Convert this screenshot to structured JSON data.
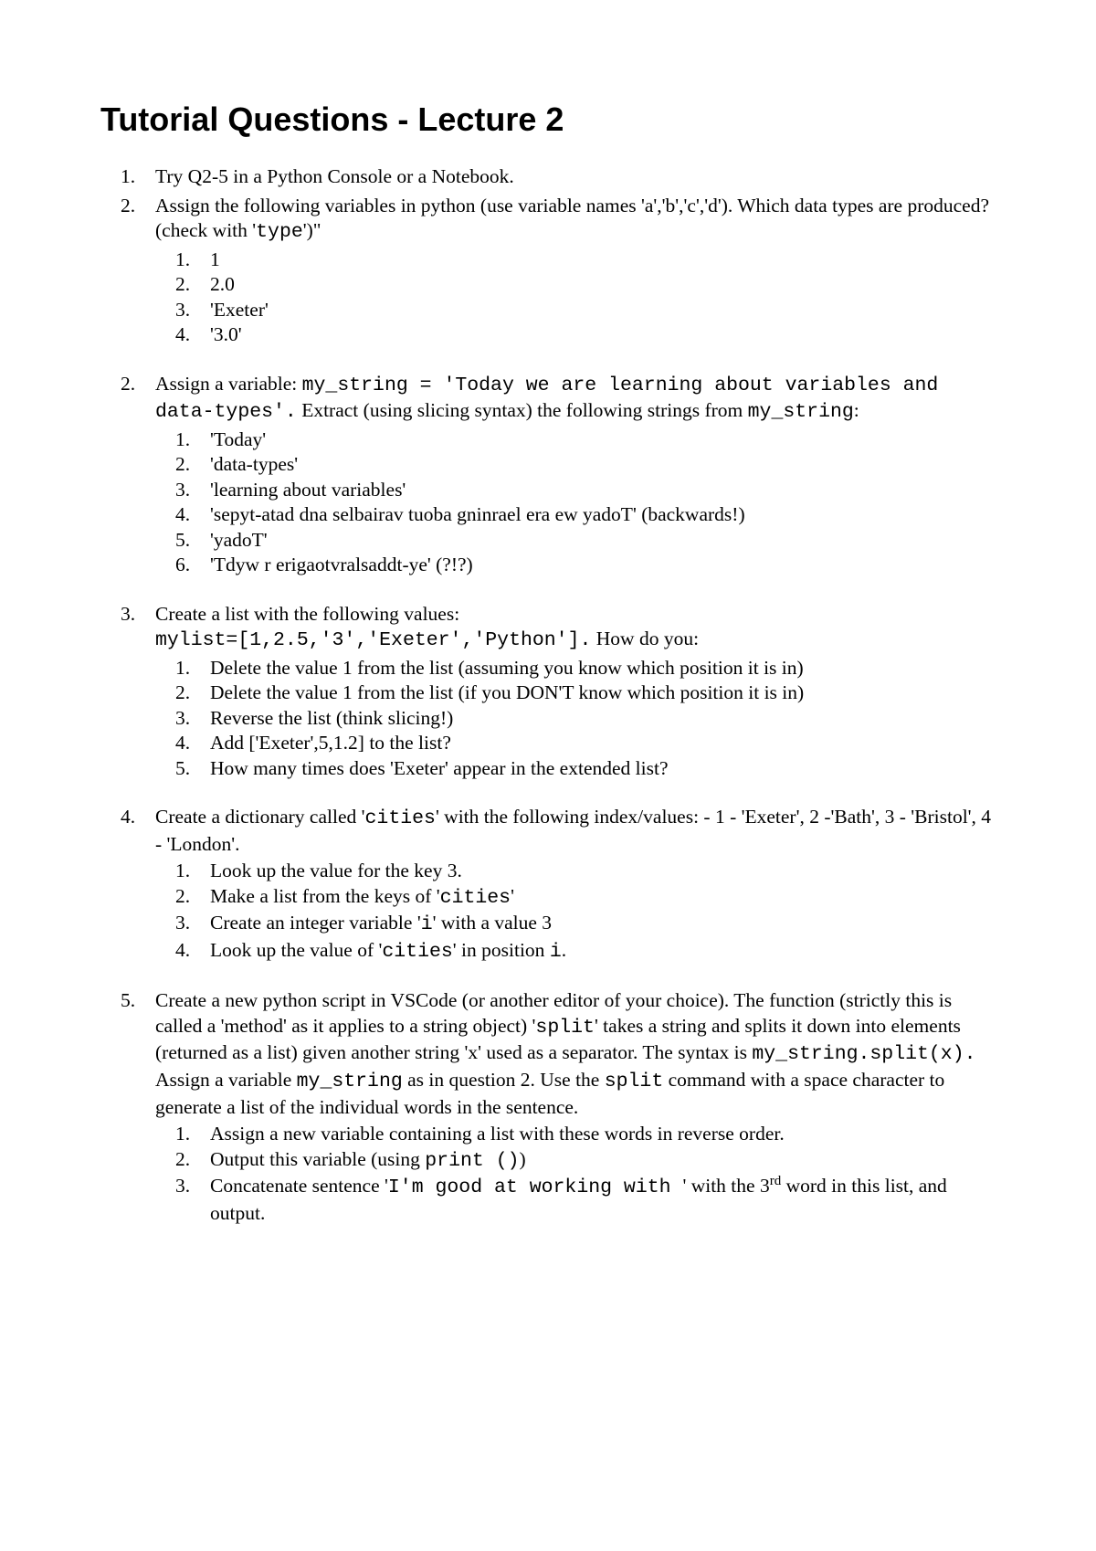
{
  "title": "Tutorial Questions - Lecture 2",
  "q1": {
    "num": "1.",
    "text": "Try Q2-5 in a Python Console or a Notebook."
  },
  "q2a": {
    "num": "2.",
    "text_a": "Assign the following variables in python (use variable names 'a','b','c','d'). Which data types are produced? (check with '",
    "code": "type",
    "text_b": "')\"",
    "items": {
      "n1": "1.",
      "v1": "1",
      "n2": "2.",
      "v2": "2.0",
      "n3": "3.",
      "v3": "'Exeter'",
      "n4": "4.",
      "v4": "'3.0'"
    }
  },
  "q2b": {
    "num": "2.",
    "t1": "Assign a variable: ",
    "code1": "my_string = 'Today we are learning about variables and data-types'.",
    "t2": "  Extract  (using slicing syntax) the following strings from ",
    "code2": "my_string",
    "t3": ":",
    "items": {
      "n1": "1.",
      "v1": "'Today'",
      "n2": "2.",
      "v2": "'data-types'",
      "n3": "3.",
      "v3": "'learning about variables'",
      "n4": "4.",
      "v4": "'sepyt-atad dna selbairav tuoba gninrael era ew yadoT' (backwards!)",
      "n5": "5.",
      "v5": "'yadoT'",
      "n6": "6.",
      "v6": " 'Tdyw r erigaotvralsaddt-ye' (?!?)"
    }
  },
  "q3": {
    "num": "3.",
    "t1": "Create a list with the following values: ",
    "code1": "mylist=[1,2.5,'3','Exeter','Python'].",
    "t2": "  How do you:",
    "items": {
      "n1": "1.",
      "v1": "Delete the value 1 from the list (assuming you know which position it is in)",
      "n2": "2.",
      "v2": "Delete the value 1 from the list (if you DON'T know which position it is in)",
      "n3": "3.",
      "v3": "Reverse the list (think slicing!)",
      "n4": "4.",
      "v4": "Add ['Exeter',5,1.2] to the list?",
      "n5": "5.",
      "v5": "How many times does 'Exeter' appear in the extended list?"
    }
  },
  "q4": {
    "num": "4.",
    "t1": "Create a dictionary called '",
    "code1": "cities",
    "t2": "' with the following index/values: - 1 - 'Exeter', 2 -'Bath',  3 - 'Bristol', 4 - 'London'.",
    "items": {
      "n1": "1.",
      "v1": "Look up the value for the key 3.",
      "n2": "2.",
      "v2a": "Make a list from the keys of '",
      "v2code": "cities",
      "v2b": "'",
      "n3": "3.",
      "v3a": "Create an integer variable '",
      "v3code": "i",
      "v3b": "' with a value 3",
      "n4": "4.",
      "v4a": "Look up the value of '",
      "v4code1": "cities",
      "v4b": "' in position ",
      "v4code2": "i",
      "v4c": "."
    }
  },
  "q5": {
    "num": "5.",
    "t1": "Create a new python script in VSCode (or another editor of your choice). The function (strictly this is called a 'method' as it applies to a string object) '",
    "code1": "split",
    "t2": "' takes a string and splits it down into elements (returned as a list) given another string 'x' used as a separator. The syntax is ",
    "code2": "my_string.split(x).",
    "t3": " Assign a variable ",
    "code3": "my_string",
    "t4": " as in question 2. Use the ",
    "code4": "split",
    "t5": " command with a space character to generate a list of the individual words in the sentence.",
    "items": {
      "n1": "1.",
      "v1": "Assign a new variable containing a list with these words in reverse order.",
      "n2": "2.",
      "v2a": "Output this variable (using ",
      "v2code": "print ()",
      "v2b": ")",
      "n3": "3.",
      "v3a": "Concatenate sentence '",
      "v3code": "I'm good at working with ",
      "v3b": "' with the 3",
      "v3sup": "rd",
      "v3c": " word in this list, and output."
    }
  }
}
